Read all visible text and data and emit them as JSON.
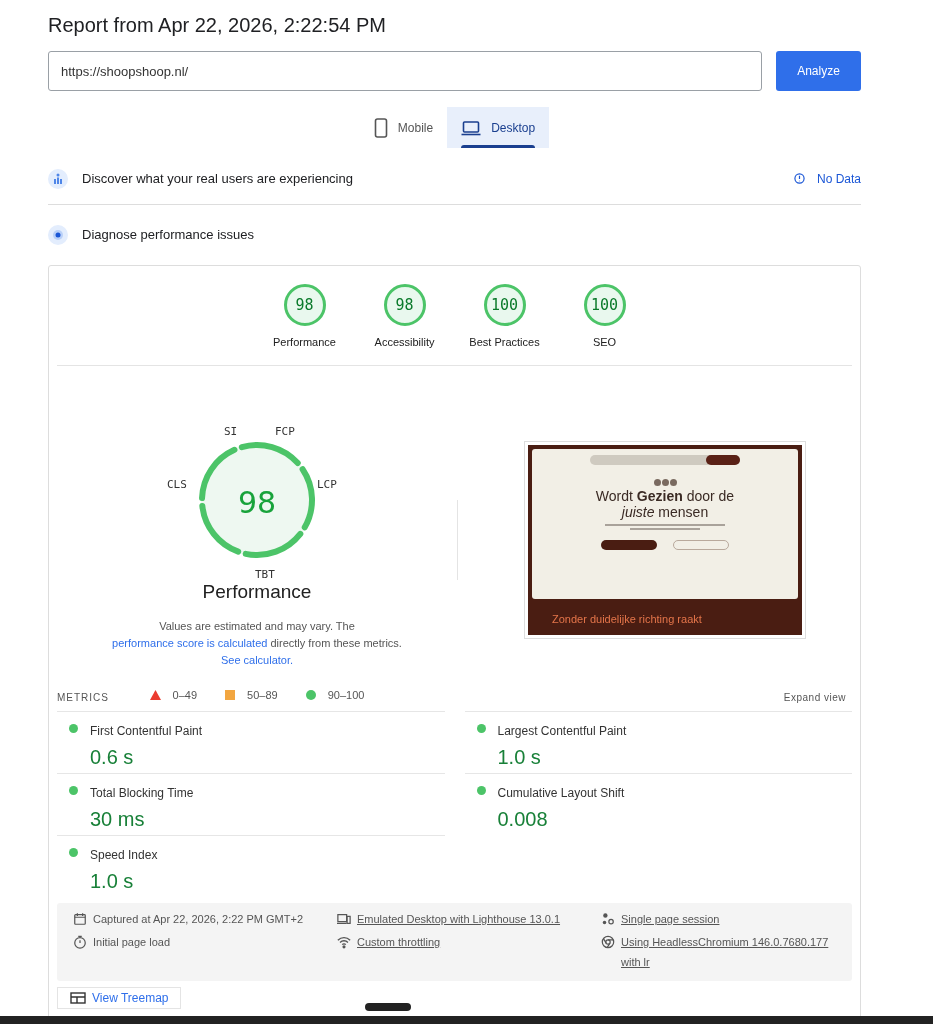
{
  "title": "Report from Apr 22, 2026, 2:22:54 PM",
  "url_field": {
    "value": "https://shoopshoop.nl/"
  },
  "analyze_button": "Analyze",
  "device_tabs": [
    {
      "label": "Mobile",
      "kind": "phone",
      "selected": false
    },
    {
      "label": "Desktop",
      "kind": "laptop",
      "selected": true
    }
  ],
  "sections": [
    {
      "title": "Discover what your real users are experiencing",
      "kind": "users",
      "status": "No Data"
    },
    {
      "title": "Diagnose performance issues",
      "kind": "diagnose"
    }
  ],
  "category_scores": [
    {
      "score": "98",
      "label": "Performance"
    },
    {
      "score": "98",
      "label": "Accessibility"
    },
    {
      "score": "100",
      "label": "Best Practices"
    },
    {
      "score": "100",
      "label": "SEO"
    }
  ],
  "main_gauge": {
    "score": "98",
    "title": "Performance",
    "segments": [
      "SI",
      "FCP",
      "LCP",
      "TBT",
      "CLS"
    ]
  },
  "note": {
    "before": "Values are estimated and may vary. The ",
    "link1": "performance score is calculated",
    "middle": " directly from these metrics. ",
    "link2": "See calculator."
  },
  "legend": [
    {
      "kind": "triangle",
      "label": "0–49",
      "color": "#eb3b2f"
    },
    {
      "kind": "square",
      "label": "50–89",
      "color": "#f2a640"
    },
    {
      "kind": "circle",
      "label": "90–100",
      "color": "#4cc468"
    }
  ],
  "preview": {
    "headline": "Wordt **Gezien** door de *juiste* mensen",
    "footer_text": "Zonder duidelijke richting raakt"
  },
  "metrics_header": {
    "title": "METRICS",
    "expand": "Expand view"
  },
  "metrics": [
    {
      "name": "First Contentful Paint",
      "value": "0.6 s",
      "color": "#4cc468"
    },
    {
      "name": "Largest Contentful Paint",
      "value": "1.0 s",
      "color": "#4cc468"
    },
    {
      "name": "Total Blocking Time",
      "value": "30 ms",
      "color": "#4cc468"
    },
    {
      "name": "Cumulative Layout Shift",
      "value": "0.008",
      "color": "#4cc468"
    },
    {
      "name": "Speed Index",
      "value": "1.0 s",
      "color": "#4cc468"
    }
  ],
  "run_info": [
    {
      "text": "Captured at Apr 22, 2026, 2:22 PM GMT+2",
      "kind": "calendar",
      "link": false
    },
    {
      "text": "Emulated Desktop with Lighthouse 13.0.1",
      "kind": "devices",
      "link": true
    },
    {
      "text": "Single page session",
      "kind": "session",
      "link": true
    },
    {
      "text": "Initial page load",
      "kind": "timer",
      "link": false
    },
    {
      "text": "Custom throttling",
      "kind": "wifi",
      "link": true
    },
    {
      "text": "Using HeadlessChromium 146.0.7680.177 with lr",
      "kind": "browser",
      "link": true
    }
  ],
  "treemap_button": "View Treemap"
}
